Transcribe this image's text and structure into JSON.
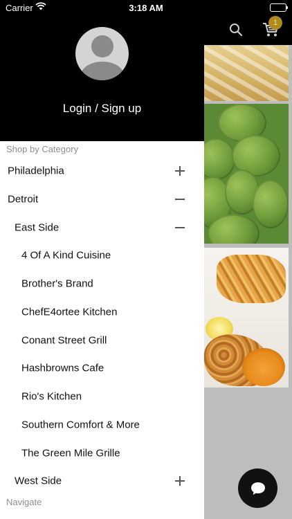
{
  "status_bar": {
    "carrier": "Carrier",
    "time": "3:18 AM"
  },
  "header": {
    "cart_count": "1",
    "icons": {
      "search": "search-icon",
      "cart": "shopping-cart-icon"
    }
  },
  "drawer": {
    "login_label": "Login / Sign up",
    "shop_section_label": "Shop by Category",
    "categories": [
      {
        "label": "Philadelphia",
        "state": "collapsed"
      },
      {
        "label": "Detroit",
        "state": "expanded"
      },
      {
        "label": "East Side",
        "state": "expanded"
      },
      {
        "label": "4 Of A Kind Cuisine"
      },
      {
        "label": "Brother's Brand"
      },
      {
        "label": "ChefE4ortee Kitchen"
      },
      {
        "label": "Conant Street Grill"
      },
      {
        "label": "Hashbrowns Cafe"
      },
      {
        "label": "Rio's Kitchen"
      },
      {
        "label": "Southern Comfort & More"
      },
      {
        "label": "The Green Mile Grille"
      },
      {
        "label": "West Side",
        "state": "collapsed"
      }
    ],
    "navigate_section_label": "Navigate"
  },
  "colors": {
    "badge": "#b08a1e",
    "drawer_header": "#000000",
    "section_label": "#8e8e8e"
  }
}
